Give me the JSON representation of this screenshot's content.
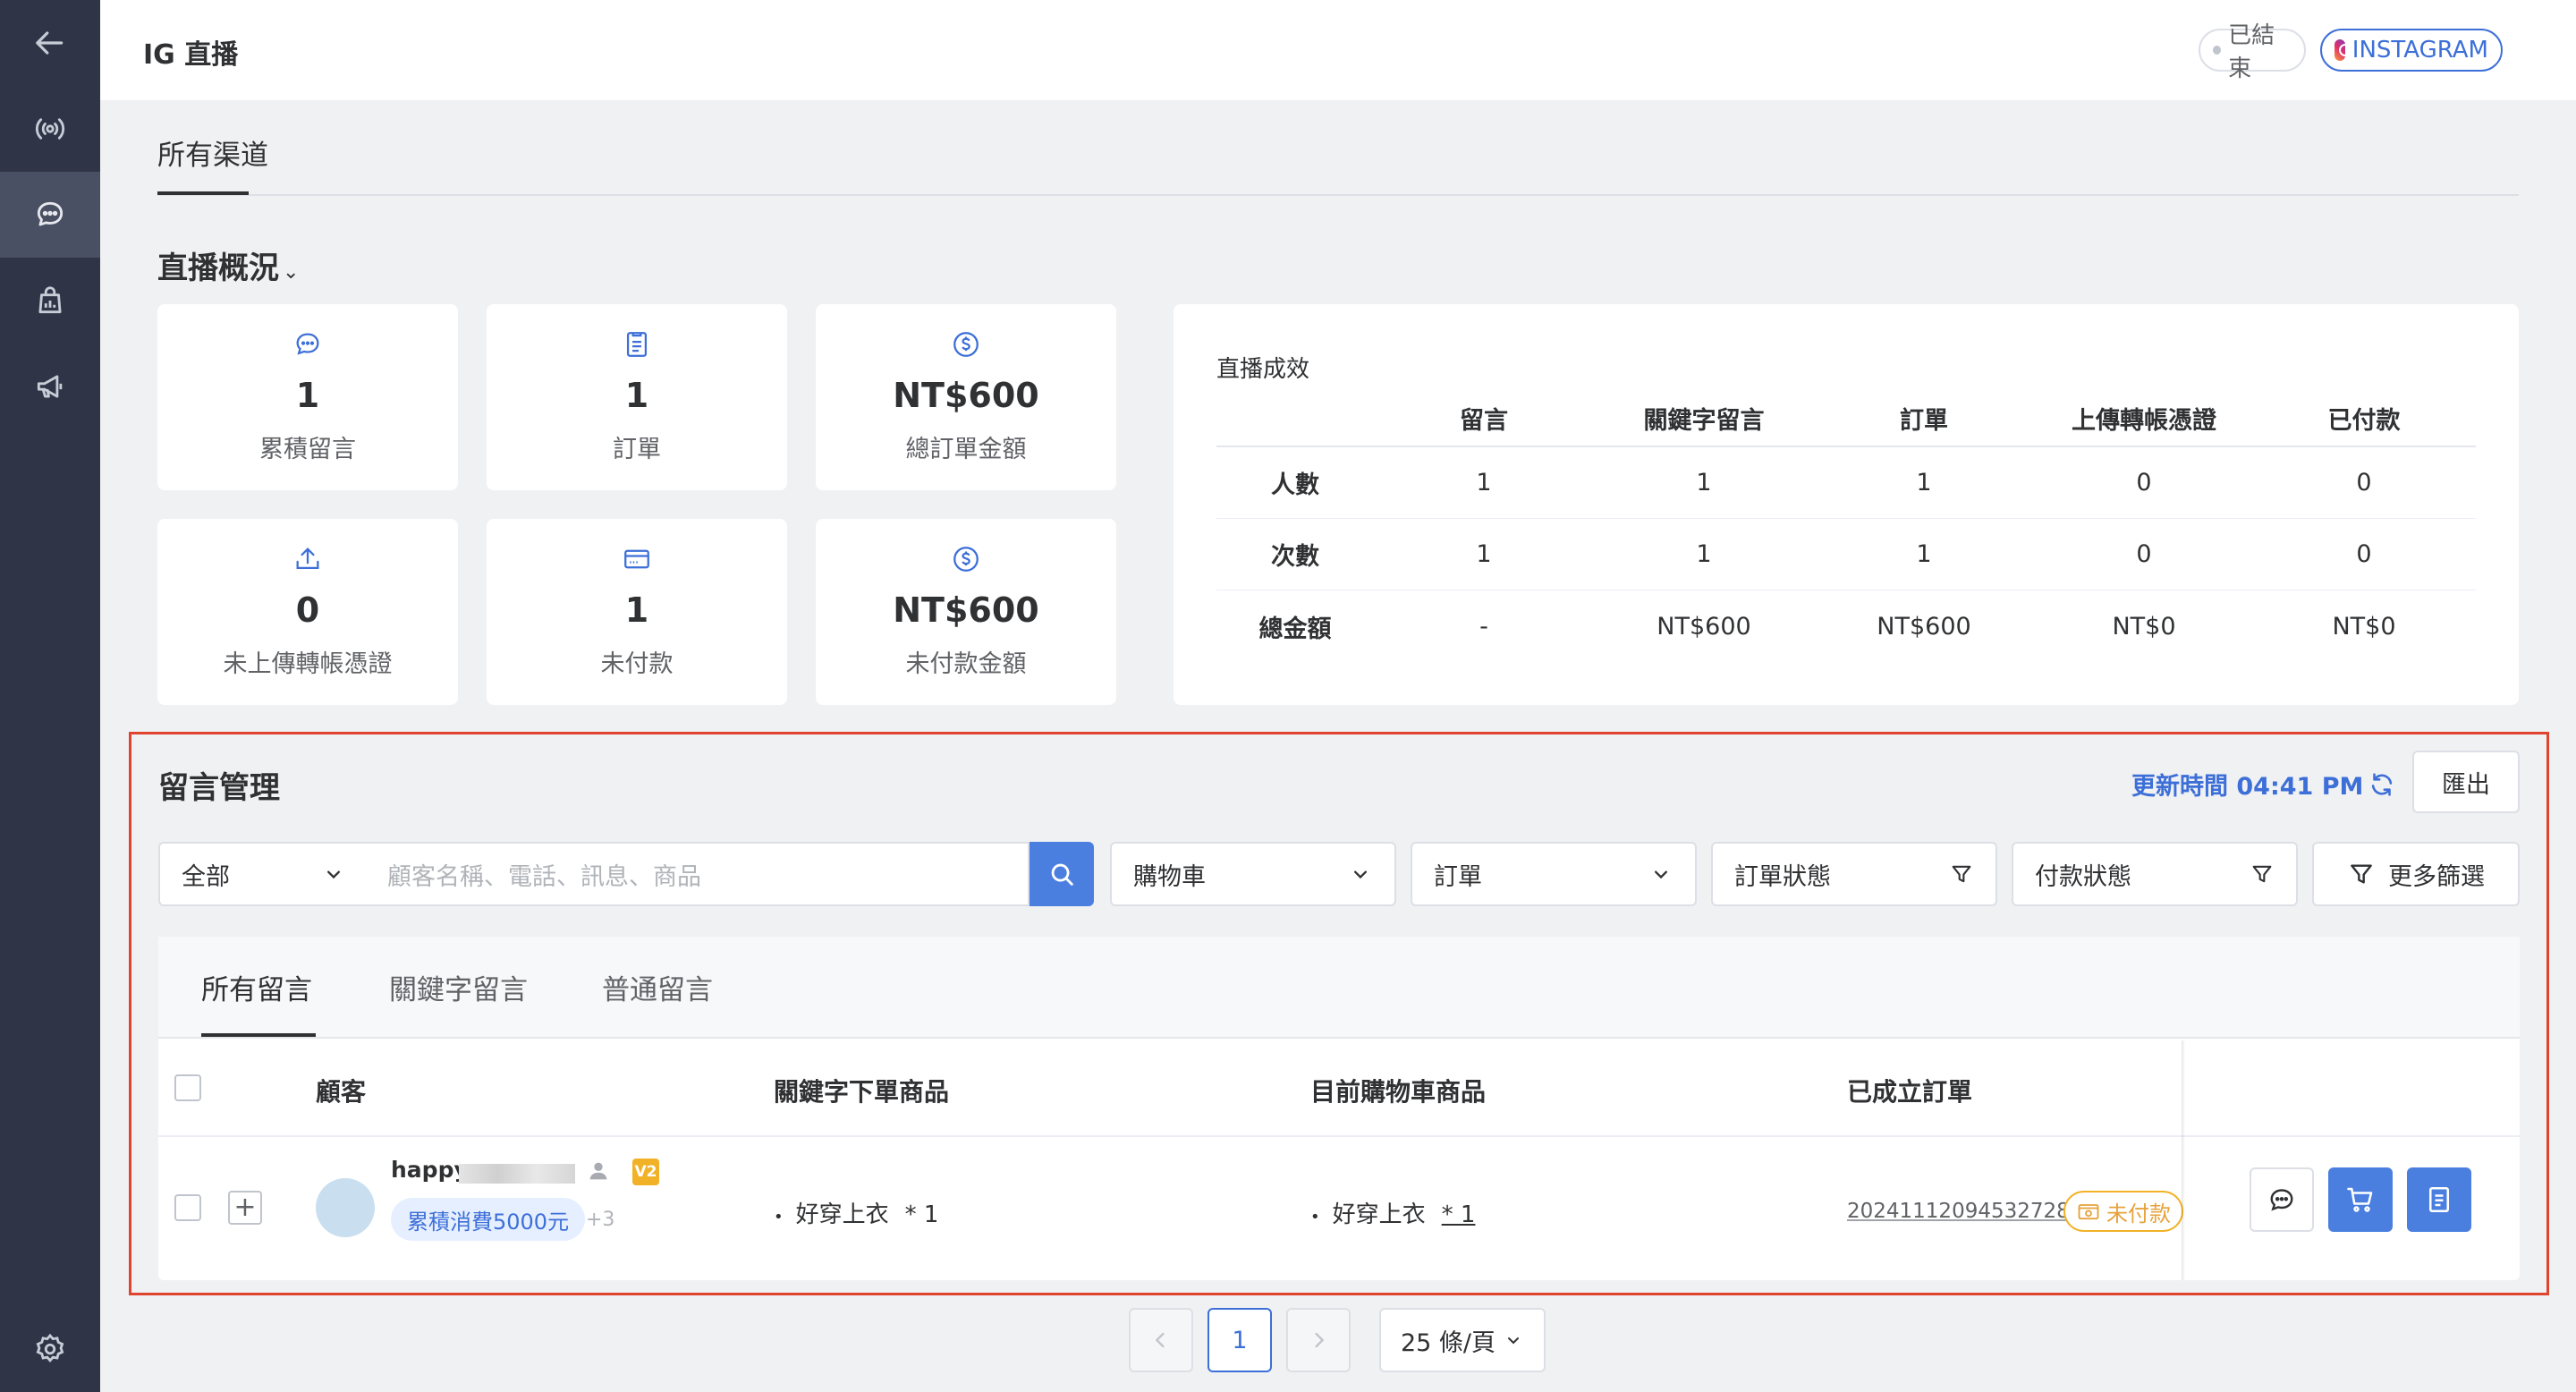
{
  "header": {
    "title": "IG 直播",
    "status_label": "已結束",
    "platform_label": "INSTAGRAM"
  },
  "sidebar": {
    "items": [
      {
        "icon": "back-arrow-icon"
      },
      {
        "icon": "broadcast-icon"
      },
      {
        "icon": "chat-bubble-icon"
      },
      {
        "icon": "shop-icon"
      },
      {
        "icon": "megaphone-icon"
      },
      {
        "icon": "gear-icon"
      }
    ],
    "active_index": 2
  },
  "channel_tab": "所有渠道",
  "overview": {
    "title": "直播概況",
    "cards": [
      {
        "icon": "chat-bubble-icon",
        "value": "1",
        "label": "累積留言"
      },
      {
        "icon": "clipboard-icon",
        "value": "1",
        "label": "訂單"
      },
      {
        "icon": "dollar-circle-icon",
        "value": "NT$600",
        "label": "總訂單金額"
      },
      {
        "icon": "upload-icon",
        "value": "0",
        "label": "未上傳轉帳憑證"
      },
      {
        "icon": "credit-card-icon",
        "value": "1",
        "label": "未付款"
      },
      {
        "icon": "dollar-circle-icon",
        "value": "NT$600",
        "label": "未付款金額"
      }
    ]
  },
  "performance": {
    "title": "直播成效",
    "columns": [
      "留言",
      "關鍵字留言",
      "訂單",
      "上傳轉帳憑證",
      "已付款"
    ],
    "rows": [
      {
        "label": "人數",
        "values": [
          "1",
          "1",
          "1",
          "0",
          "0"
        ]
      },
      {
        "label": "次數",
        "values": [
          "1",
          "1",
          "1",
          "0",
          "0"
        ]
      },
      {
        "label": "總金額",
        "values": [
          "-",
          "NT$600",
          "NT$600",
          "NT$0",
          "NT$0"
        ]
      }
    ]
  },
  "comments": {
    "title": "留言管理",
    "updated_label": "更新時間 04:41 PM",
    "export_label": "匯出",
    "scope_select": "全部",
    "search_placeholder": "顧客名稱、電話、訊息、商品",
    "filters": {
      "cart": "購物車",
      "order": "訂單",
      "order_status": "訂單狀態",
      "payment_status": "付款狀態",
      "more": "更多篩選"
    },
    "tabs": [
      "所有留言",
      "關鍵字留言",
      "普通留言"
    ],
    "columns": [
      "顧客",
      "關鍵字下單商品",
      "目前購物車商品",
      "已成立訂單"
    ],
    "rows": [
      {
        "customer_name": "happy",
        "vip_badge": "V2",
        "tag": "累積消費5000元",
        "more_tags": "+3",
        "keyword_item": "好穿上衣",
        "keyword_qty": "* 1",
        "cart_item": "好穿上衣",
        "cart_qty": "* 1",
        "order_number": "20241112094532728",
        "payment_badge": "未付款"
      }
    ]
  },
  "pagination": {
    "current_page": "1",
    "page_size": "25 條/頁"
  },
  "colors": {
    "sidebar": "#2f3547",
    "accent": "#3d6fd8",
    "button_blue": "#4a7fe0",
    "highlight_border": "#e0432e",
    "unpaid": "#e6a23c"
  }
}
